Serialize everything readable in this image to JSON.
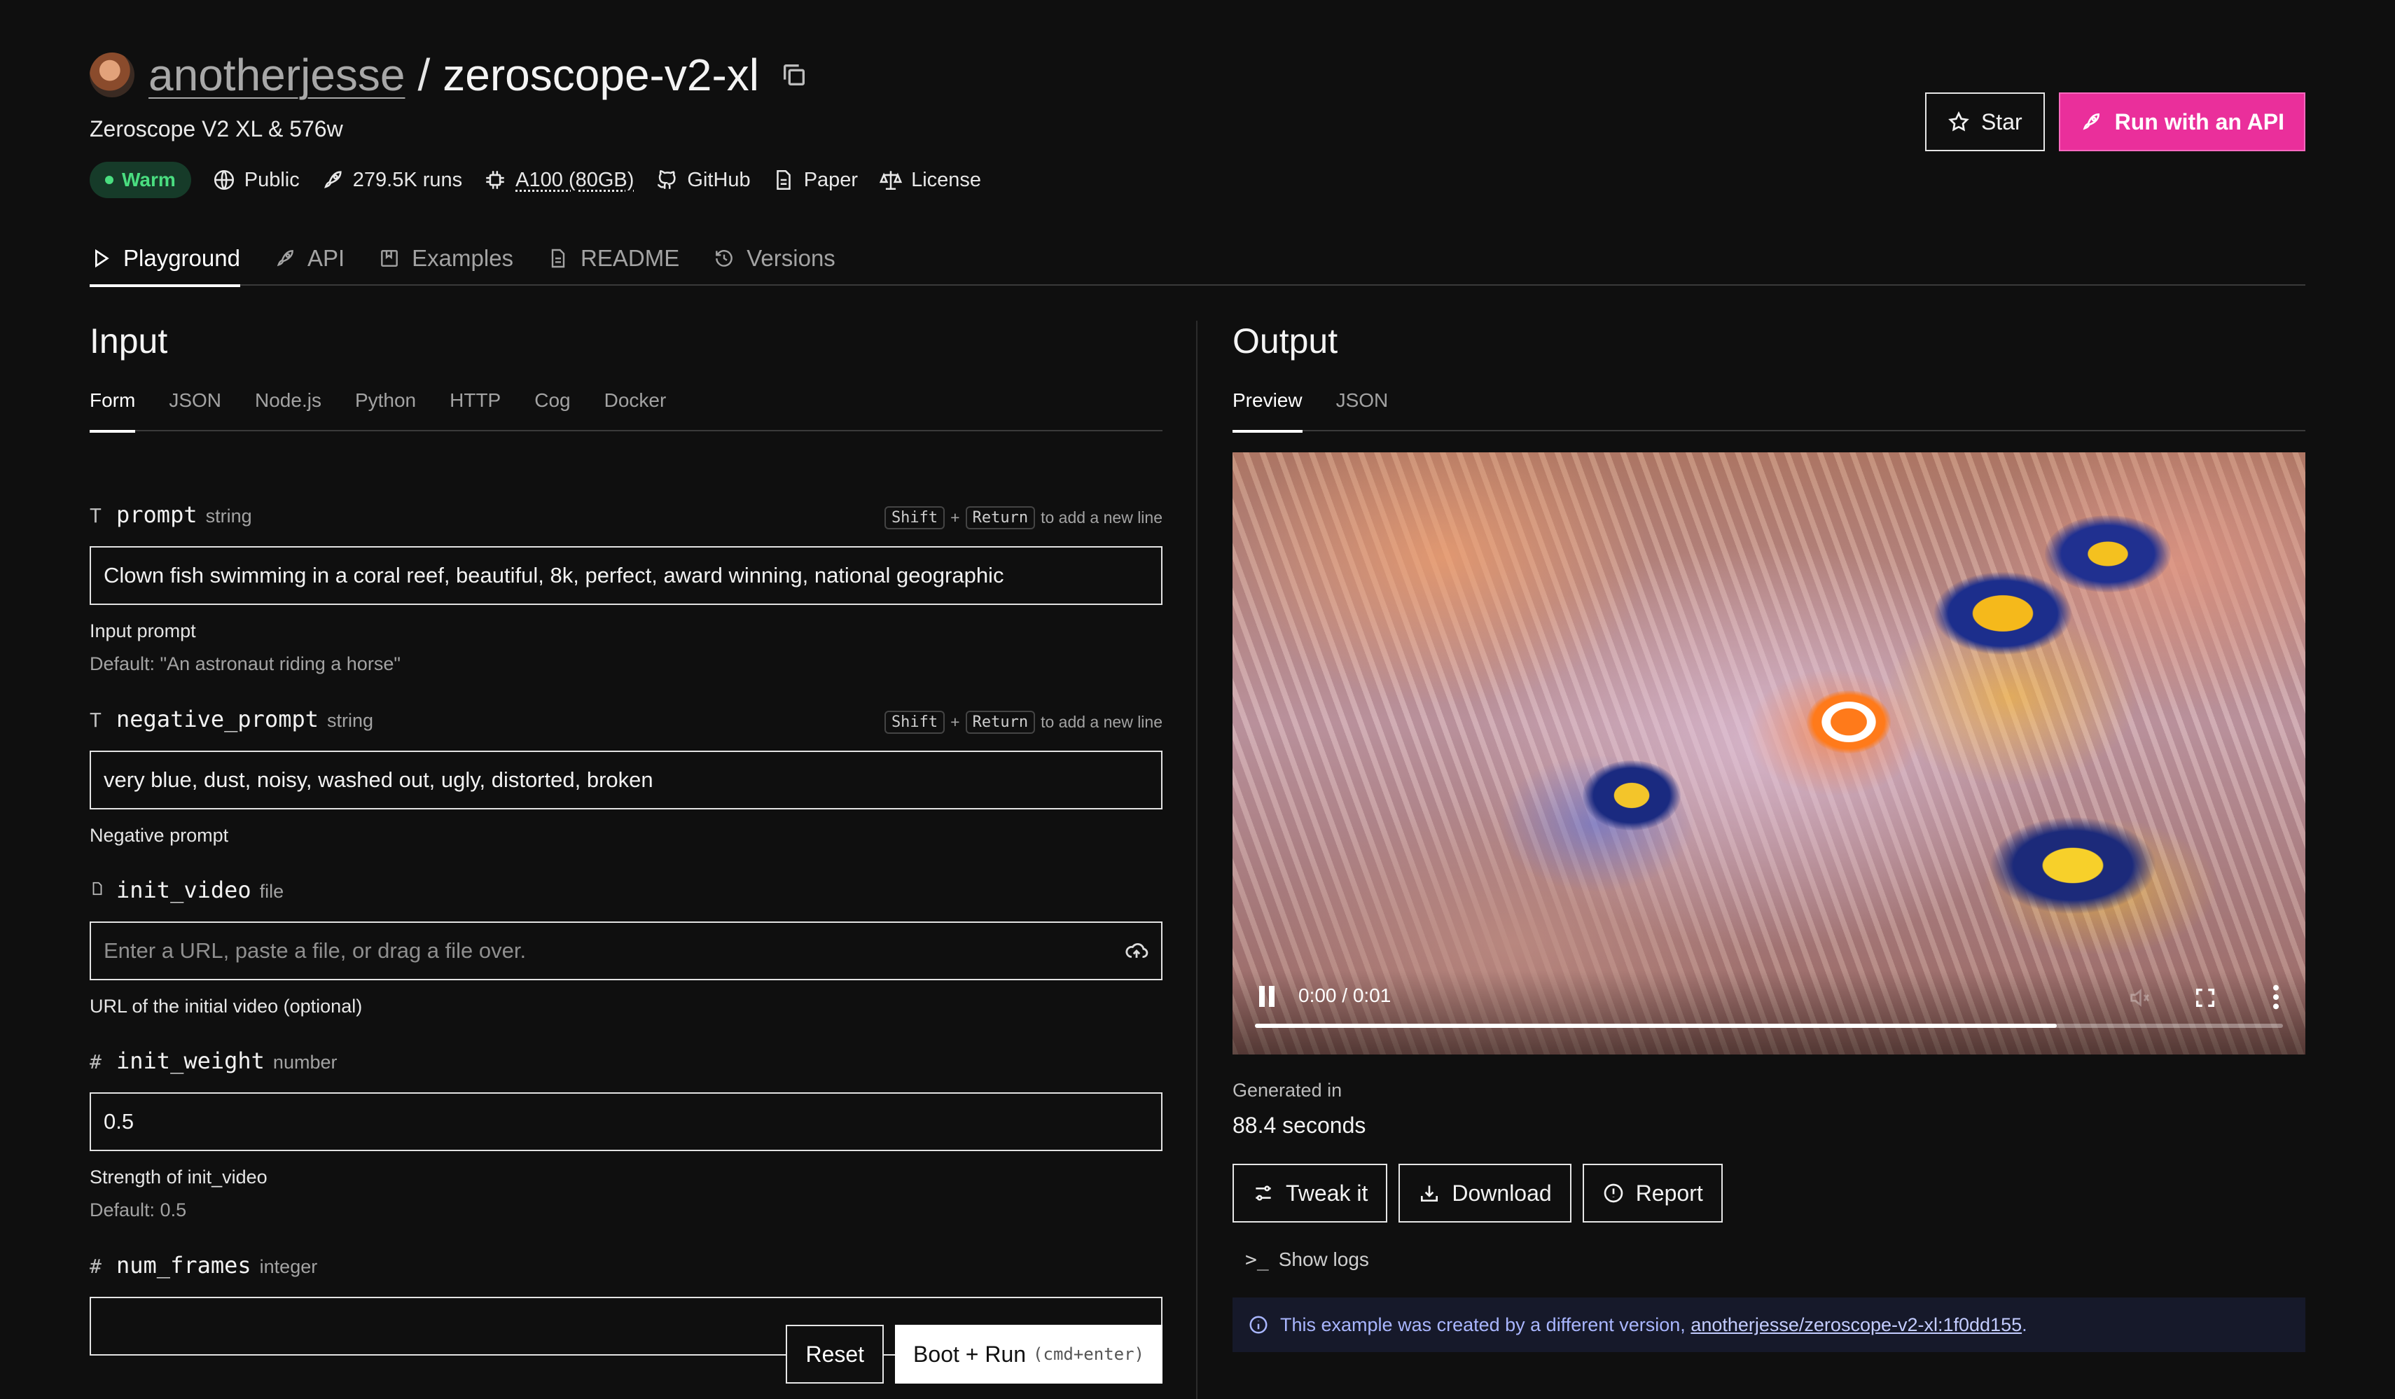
{
  "header": {
    "owner": "anotherjesse",
    "separator": "/",
    "model": "zeroscope-v2-xl",
    "subtitle": "Zeroscope V2 XL & 576w",
    "status": "Warm",
    "visibility": "Public",
    "runs": "279.5K runs",
    "hardware": "A100 (80GB)",
    "github": "GitHub",
    "paper": "Paper",
    "license": "License",
    "star_label": "Star",
    "run_api_label": "Run with an API"
  },
  "tabs": [
    {
      "label": "Playground",
      "icon": "play-icon"
    },
    {
      "label": "API",
      "icon": "rocket-icon"
    },
    {
      "label": "Examples",
      "icon": "bookmark-icon"
    },
    {
      "label": "README",
      "icon": "document-icon"
    },
    {
      "label": "Versions",
      "icon": "history-icon"
    }
  ],
  "input": {
    "title": "Input",
    "tabs": [
      "Form",
      "JSON",
      "Node.js",
      "Python",
      "HTTP",
      "Cog",
      "Docker"
    ],
    "newline_hint": {
      "key1": "Shift",
      "plus": "+",
      "key2": "Return",
      "text": "to add a new line"
    },
    "fields": {
      "prompt": {
        "icon": "T",
        "name": "prompt",
        "type": "string",
        "value": "Clown fish swimming in a coral reef, beautiful, 8k, perfect, award winning, national geographic",
        "description": "Input prompt",
        "default": "Default: \"An astronaut riding a horse\""
      },
      "negative_prompt": {
        "icon": "T",
        "name": "negative_prompt",
        "type": "string",
        "value": "very blue, dust, noisy, washed out, ugly, distorted, broken",
        "description": "Negative prompt"
      },
      "init_video": {
        "icon": "file-icon",
        "name": "init_video",
        "type": "file",
        "placeholder": "Enter a URL, paste a file, or drag a file over.",
        "description": "URL of the initial video (optional)"
      },
      "init_weight": {
        "icon": "#",
        "name": "init_weight",
        "type": "number",
        "value": "0.5",
        "description": "Strength of init_video",
        "default": "Default: 0.5"
      },
      "num_frames": {
        "icon": "#",
        "name": "num_frames",
        "type": "integer"
      }
    },
    "reset_label": "Reset",
    "run_label": "Boot + Run",
    "run_shortcut": "(cmd+enter)"
  },
  "output": {
    "title": "Output",
    "tabs": [
      "Preview",
      "JSON"
    ],
    "video": {
      "time": "0:00 / 0:01",
      "progress": 0.78
    },
    "generated_label": "Generated in",
    "generated_value": "88.4 seconds",
    "tweak_label": "Tweak it",
    "download_label": "Download",
    "report_label": "Report",
    "show_logs_label": "Show logs",
    "info_text": "This example was created by a different version,",
    "info_link": "anotherjesse/zeroscope-v2-xl:1f0dd155",
    "info_end": "."
  },
  "colors": {
    "accent_pink": "#ea2f9b",
    "warm_green": "#4ade80",
    "background": "#0f0f0f"
  }
}
